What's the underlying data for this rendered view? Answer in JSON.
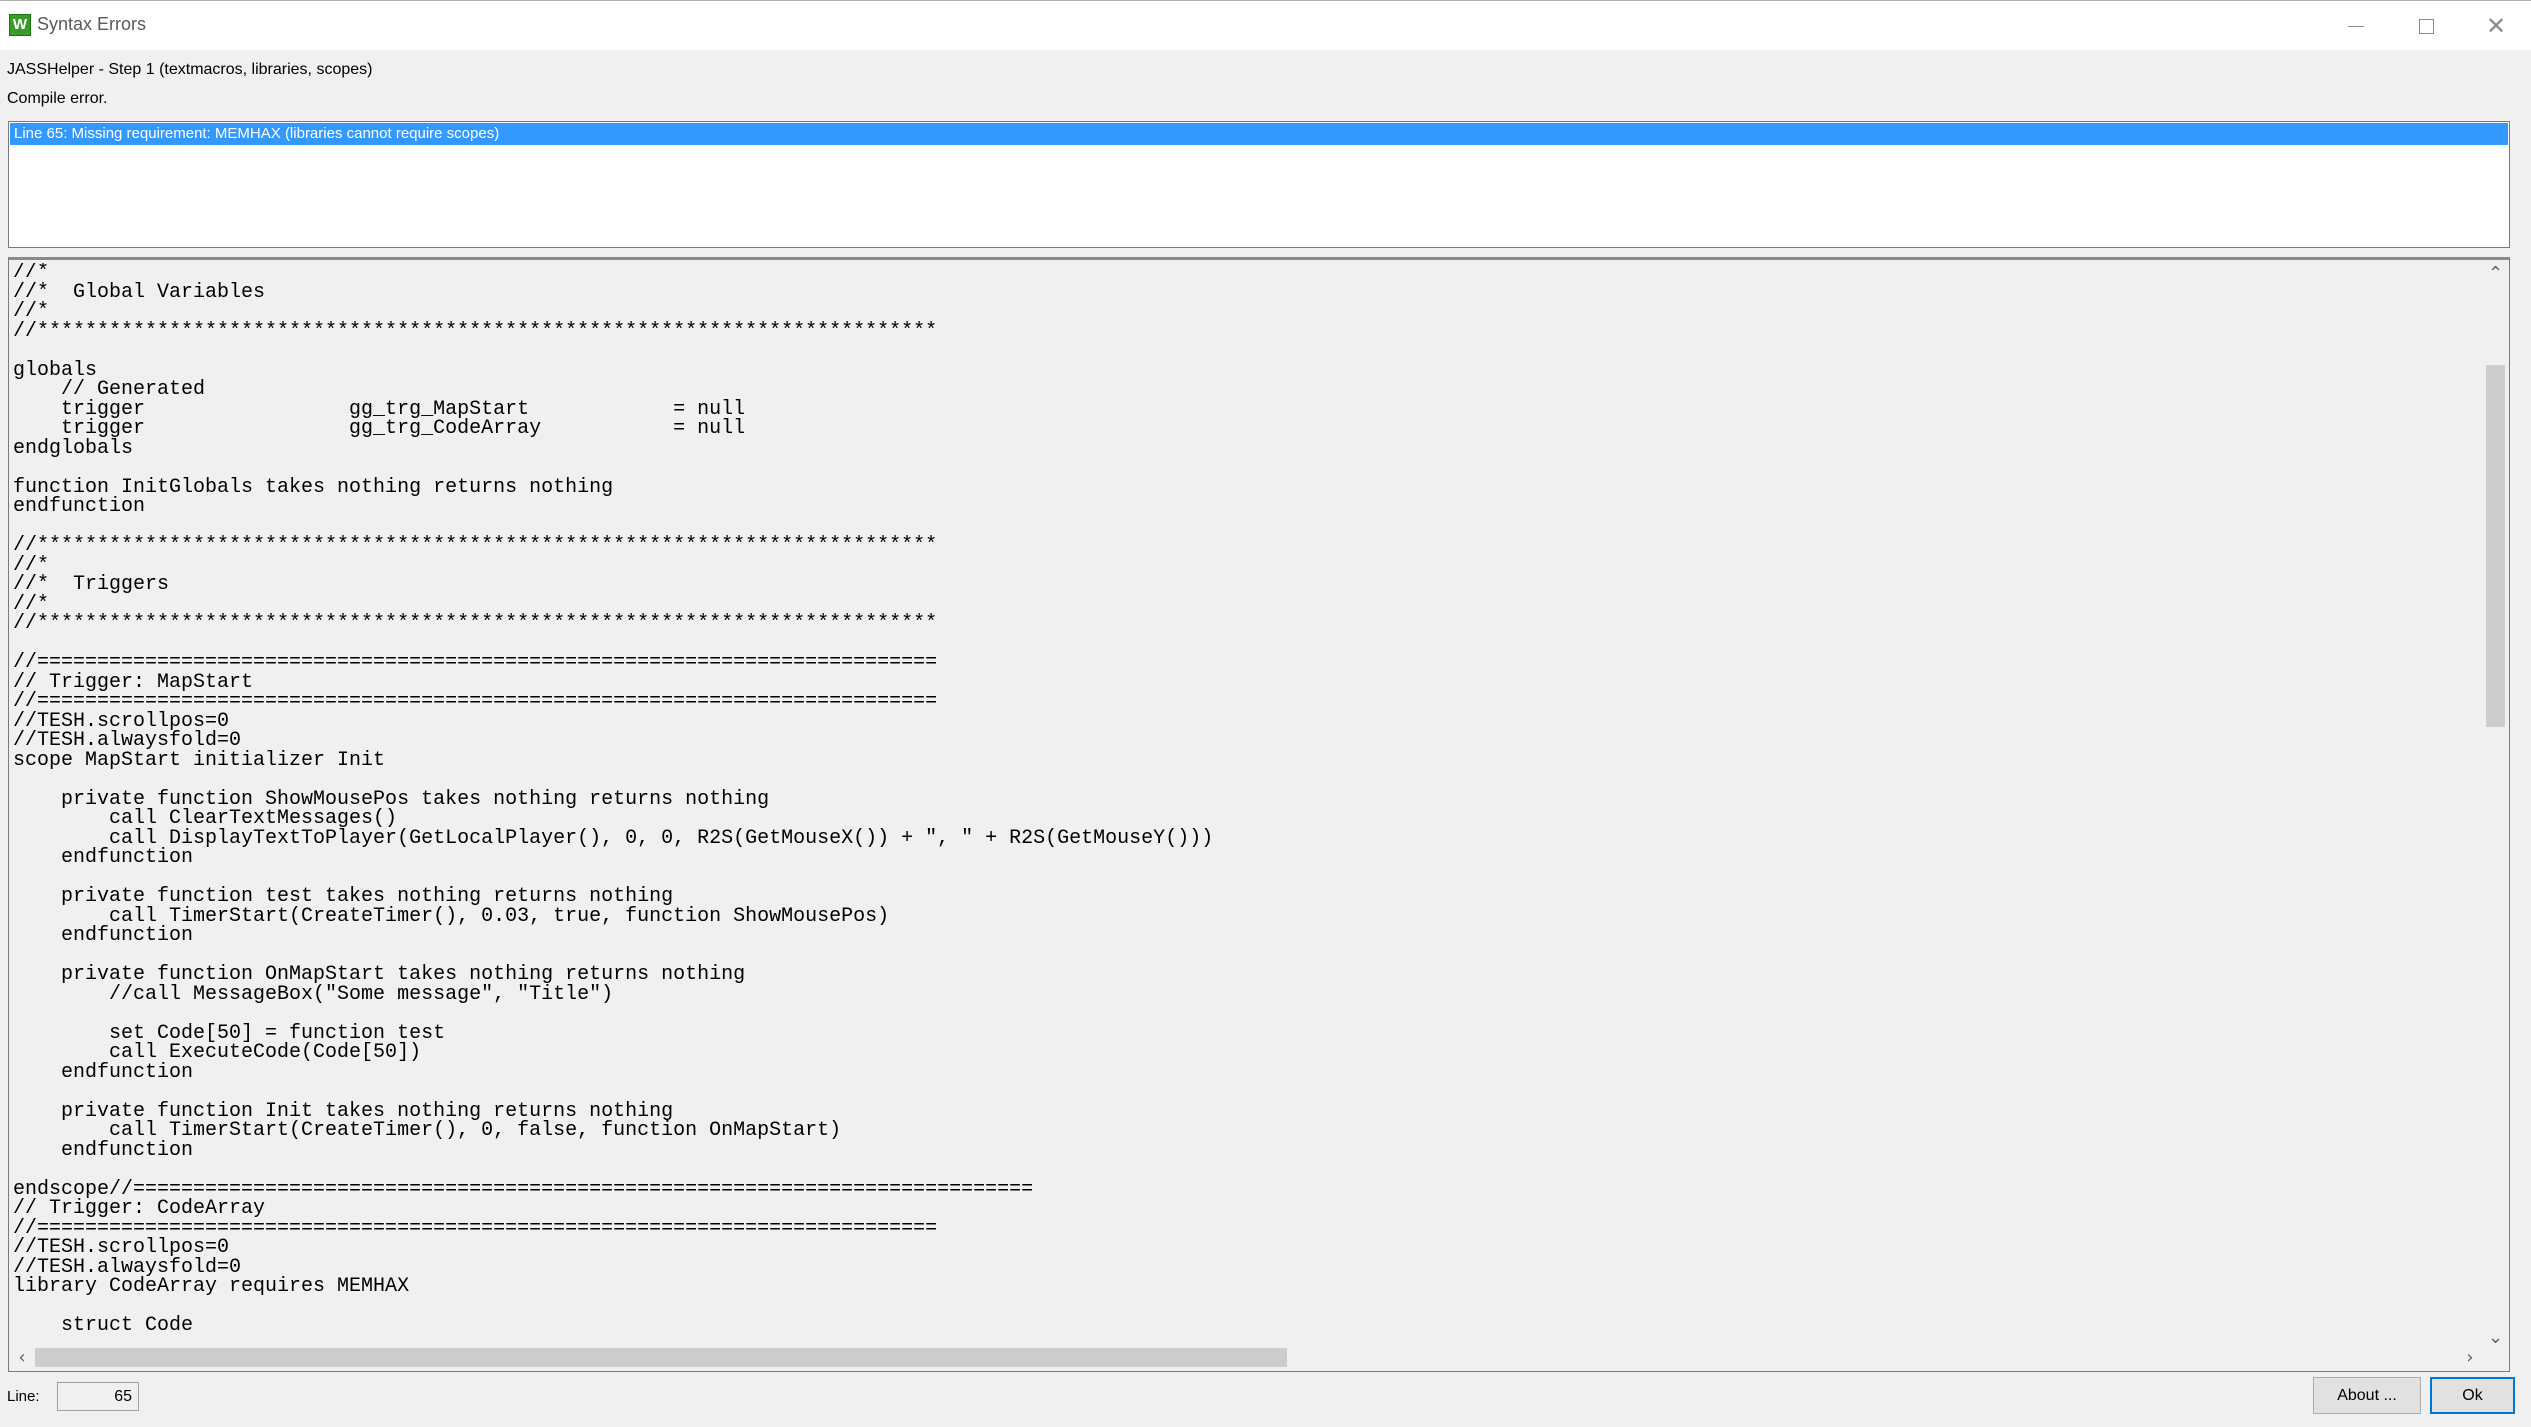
{
  "window": {
    "title": "Syntax Errors",
    "icon": "app-icon",
    "icon_glyph": "W",
    "controls": [
      "minimize",
      "maximize",
      "close"
    ]
  },
  "header": {
    "step": "JASSHelper - Step 1 (textmacros, libraries, scopes)",
    "status": "Compile error."
  },
  "errors": [
    {
      "text": "Line 65: Missing requirement: MEMHAX (libraries cannot require scopes)",
      "selected": true
    }
  ],
  "code_lines": [
    "//*",
    "//*  Global Variables",
    "//*",
    "//***************************************************************************",
    "",
    "globals",
    "    // Generated",
    "    trigger                 gg_trg_MapStart            = null",
    "    trigger                 gg_trg_CodeArray           = null",
    "endglobals",
    "",
    "function InitGlobals takes nothing returns nothing",
    "endfunction",
    "",
    "//***************************************************************************",
    "//*",
    "//*  Triggers",
    "//*",
    "//***************************************************************************",
    "",
    "//===========================================================================",
    "// Trigger: MapStart",
    "//===========================================================================",
    "//TESH.scrollpos=0",
    "//TESH.alwaysfold=0",
    "scope MapStart initializer Init",
    "",
    "    private function ShowMousePos takes nothing returns nothing",
    "        call ClearTextMessages()",
    "        call DisplayTextToPlayer(GetLocalPlayer(), 0, 0, R2S(GetMouseX()) + \", \" + R2S(GetMouseY()))",
    "    endfunction",
    "",
    "    private function test takes nothing returns nothing",
    "        call TimerStart(CreateTimer(), 0.03, true, function ShowMousePos)",
    "    endfunction",
    "",
    "    private function OnMapStart takes nothing returns nothing",
    "        //call MessageBox(\"Some message\", \"Title\")",
    "",
    "        set Code[50] = function test",
    "        call ExecuteCode(Code[50])",
    "    endfunction",
    "",
    "    private function Init takes nothing returns nothing",
    "        call TimerStart(CreateTimer(), 0, false, function OnMapStart)",
    "    endfunction",
    "",
    "endscope//===========================================================================",
    "// Trigger: CodeArray",
    "//===========================================================================",
    "//TESH.scrollpos=0",
    "//TESH.alwaysfold=0",
    "library CodeArray requires MEMHAX",
    "",
    "    struct Code"
  ],
  "footer": {
    "line_label": "Line:",
    "line_value": "65",
    "about_label": "About ...",
    "ok_label": "Ok"
  },
  "colors": {
    "selection": "#3399ff",
    "background": "#f0f0f0",
    "ok_border": "#0078d7"
  }
}
